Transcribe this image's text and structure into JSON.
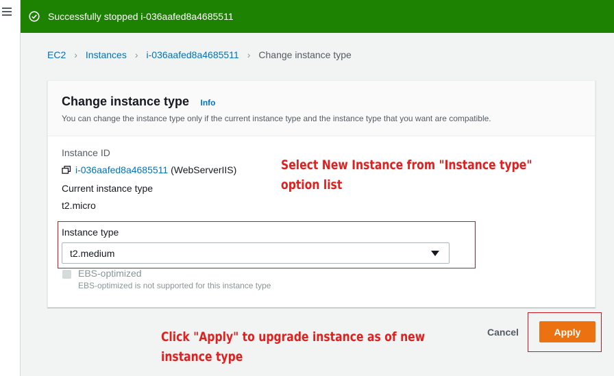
{
  "flash": {
    "message": "Successfully stopped i-036aafed8a4685511",
    "icon": "check-circle-icon",
    "color": "#1d8102"
  },
  "breadcrumb": {
    "items": [
      "EC2",
      "Instances",
      "i-036aafed8a4685511"
    ],
    "current": "Change instance type"
  },
  "panel": {
    "title": "Change instance type",
    "info": "Info",
    "description": "You can change the instance type only if the current instance type and the instance type that you want are compatible."
  },
  "instance": {
    "id_label": "Instance ID",
    "id": "i-036aafed8a4685511",
    "name": "(WebServerIIS)",
    "current_type_label": "Current instance type",
    "current_type": "t2.micro"
  },
  "instance_type": {
    "label": "Instance type",
    "selected": "t2.medium"
  },
  "ebs": {
    "label": "EBS-optimized",
    "note": "EBS-optimized is not supported for this instance type"
  },
  "annotations": {
    "select": [
      "Select New Instance from \"Instance type\"",
      "option list"
    ],
    "apply": [
      "Click \"Apply\" to upgrade instance as of new",
      "instance type"
    ]
  },
  "actions": {
    "cancel": "Cancel",
    "apply": "Apply",
    "apply_color": "#ec7211"
  }
}
